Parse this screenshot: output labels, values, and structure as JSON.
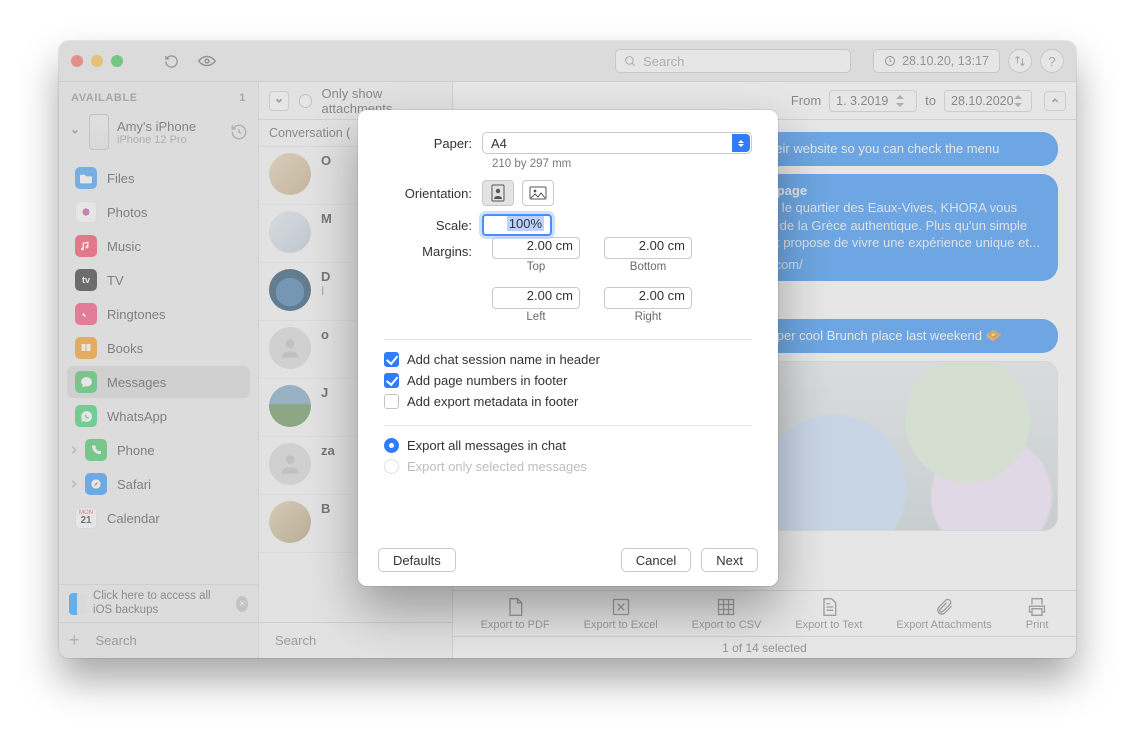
{
  "titlebar": {
    "search_placeholder": "Search",
    "date": "28.10.20, 13:17",
    "help": "?"
  },
  "sidebar": {
    "available_label": "AVAILABLE",
    "available_count": "1",
    "device_name": "Amy's iPhone",
    "device_sub": "iPhone 12 Pro",
    "items": [
      {
        "label": "Files"
      },
      {
        "label": "Photos"
      },
      {
        "label": "Music"
      },
      {
        "label": "TV"
      },
      {
        "label": "Ringtones"
      },
      {
        "label": "Books"
      },
      {
        "label": "Messages"
      },
      {
        "label": "WhatsApp"
      },
      {
        "label": "Phone"
      },
      {
        "label": "Safari"
      },
      {
        "label": "Calendar"
      }
    ],
    "cal_mon": "MON",
    "cal_day": "21",
    "hint": "Click here to access all iOS backups",
    "bottom_search_placeholder": "Search"
  },
  "conv": {
    "filter_label": "Only show attachments",
    "header_label": "Conversation (",
    "items": [
      {
        "n": "O",
        "p": ""
      },
      {
        "n": "M",
        "p": ""
      },
      {
        "n": "D",
        "p": "I"
      },
      {
        "n": "o",
        "p": ""
      },
      {
        "n": "J",
        "p": ""
      },
      {
        "n": "za",
        "p": ""
      },
      {
        "n": "B",
        "p": ""
      }
    ],
    "search_placeholder": "Search"
  },
  "chat": {
    "from_label": "From",
    "to_label": "to",
    "date_from": "1.  3.2019",
    "date_to": "28.10.2020",
    "bubble1": "to their website so you can check the menu",
    "bubble2_title": "omepage",
    "bubble2_body": "dans le quartier des Eaux-Vives, KHORA vous peur de la Grèce authentique. Plus qu'un simple urant propose de vivre une expérience unique et...",
    "bubble2_url": "eve.com/",
    "bubble3": "is super cool Brunch place last weekend 🧇",
    "toolbar": [
      {
        "label": "Export to PDF"
      },
      {
        "label": "Export to Excel"
      },
      {
        "label": "Export to CSV"
      },
      {
        "label": "Export to Text"
      },
      {
        "label": "Export Attachments"
      },
      {
        "label": "Print"
      }
    ],
    "status": "1 of 14 selected"
  },
  "modal": {
    "paper_label": "Paper:",
    "paper_value": "A4",
    "paper_dim": "210 by 297 mm",
    "orientation_label": "Orientation:",
    "scale_label": "Scale:",
    "scale_value": "100%",
    "margins_label": "Margins:",
    "m_top": "2.00 cm",
    "m_top_l": "Top",
    "m_bottom": "2.00 cm",
    "m_bottom_l": "Bottom",
    "m_left": "2.00 cm",
    "m_left_l": "Left",
    "m_right": "2.00 cm",
    "m_right_l": "Right",
    "chk_header": "Add chat session name in header",
    "chk_page": "Add page numbers in footer",
    "chk_meta": "Add export metadata in footer",
    "rad_all": "Export all messages in chat",
    "rad_sel": "Export only selected messages",
    "btn_defaults": "Defaults",
    "btn_cancel": "Cancel",
    "btn_next": "Next"
  }
}
